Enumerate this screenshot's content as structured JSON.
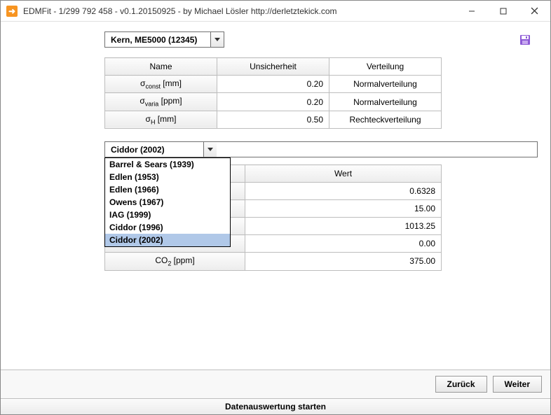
{
  "title": "EDMFit - 1/299 792 458 - v0.1.20150925 - by Michael Lösler http://derletztekick.com",
  "instrument": "Kern, ME5000 (12345)",
  "table1": {
    "headers": [
      "Name",
      "Unsicherheit",
      "Verteilung"
    ],
    "rows": [
      {
        "name_html": "σ<span class='sub'>const</span> [mm]",
        "unc": "0.20",
        "dist": "Normalverteilung"
      },
      {
        "name_html": "σ<span class='sub'>varia</span> [ppm]",
        "unc": "0.20",
        "dist": "Normalverteilung"
      },
      {
        "name_html": "σ<span class='sub'>H</span> [mm]",
        "unc": "0.50",
        "dist": "Rechteckverteilung"
      }
    ]
  },
  "model_combo": "Ciddor (2002)",
  "model_options": [
    "Barrel & Sears (1939)",
    "Edlen (1953)",
    "Edlen (1966)",
    "Owens (1967)",
    "IAG (1999)",
    "Ciddor (1996)",
    "Ciddor (2002)"
  ],
  "model_selected_index": 6,
  "table2": {
    "headers": [
      "",
      "Wert"
    ],
    "rows": [
      {
        "name_html": "",
        "val": "0.6328"
      },
      {
        "name_html": "",
        "val": "15.00"
      },
      {
        "name_html": "",
        "val": "1013.25"
      },
      {
        "name_html": "",
        "val": "0.00"
      },
      {
        "name_html": "CO<span class='sub'>2</span> [ppm]",
        "val": "375.00"
      }
    ]
  },
  "buttons": {
    "back": "Zurück",
    "next": "Weiter"
  },
  "startbar": "Datenauswertung starten"
}
